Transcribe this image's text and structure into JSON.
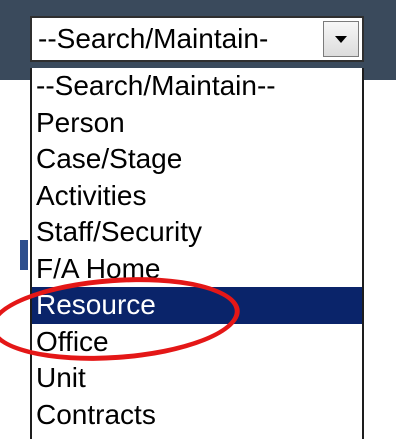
{
  "select": {
    "value": "--Search/Maintain-",
    "arrow_icon": "chevron-down-icon"
  },
  "dropdown": {
    "options": [
      "--Search/Maintain--",
      "Person",
      "Case/Stage",
      "Activities",
      "Staff/Security",
      "F/A Home",
      "Resource",
      "Office",
      "Unit",
      "Contracts"
    ],
    "selected_index": 6,
    "selected_color": "#0a246a"
  },
  "annotation": {
    "type": "ellipse",
    "color": "#e41717"
  }
}
